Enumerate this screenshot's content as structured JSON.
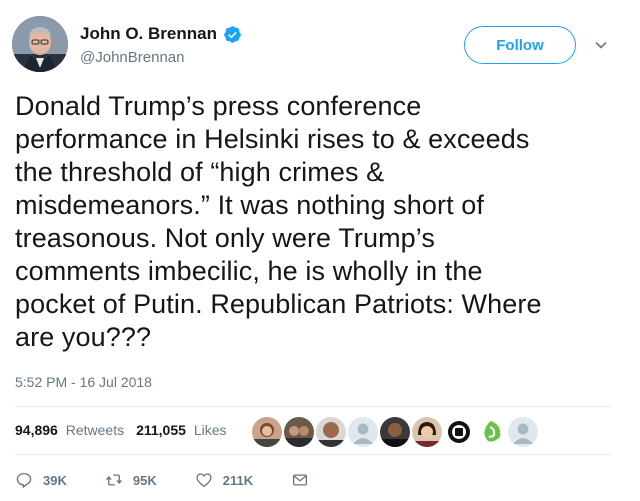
{
  "header": {
    "author_name": "John O. Brennan",
    "handle": "@JohnBrennan",
    "follow_label": "Follow"
  },
  "tweet": {
    "lines": [
      "Donald Trump’s press conference",
      "performance in Helsinki rises to & exceeds",
      "the threshold of “high crimes &",
      "misdemeanors.” It was nothing short of",
      "treasonous. Not only were Trump’s",
      "comments imbecilic, he is wholly in the",
      "pocket of Putin. Republican Patriots: Where",
      "are you???"
    ],
    "timestamp": "5:52 PM - 16 Jul 2018"
  },
  "stats": {
    "retweets_count": "94,896",
    "retweets_label": "Retweets",
    "likes_count": "211,055",
    "likes_label": "Likes"
  },
  "actions": {
    "reply_count": "39K",
    "retweet_count": "95K",
    "like_count": "211K"
  },
  "colors": {
    "brand": "#1da1f2",
    "text": "#14171a",
    "muted": "#657786",
    "divider": "#e6ecf0"
  }
}
